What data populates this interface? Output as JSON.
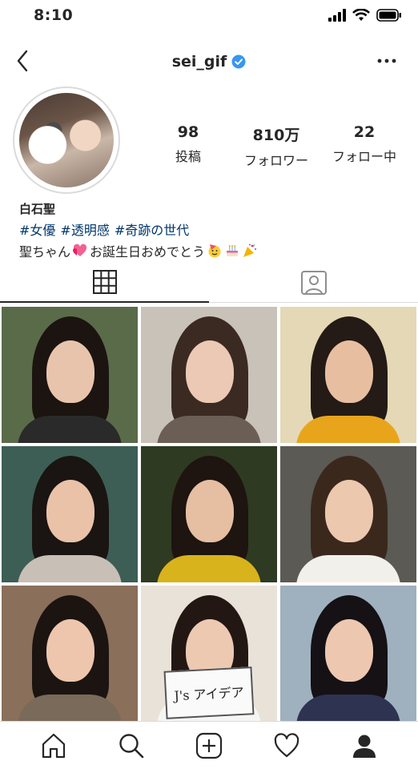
{
  "status_bar": {
    "time": "8:10"
  },
  "header": {
    "username": "sei_gif"
  },
  "profile": {
    "stats": [
      {
        "num": "98",
        "label": "投稿"
      },
      {
        "num": "810万",
        "label": "フォロワー"
      },
      {
        "num": "22",
        "label": "フォロー中"
      }
    ],
    "name": "白石聖",
    "hashtags": [
      "#女優",
      "#透明感",
      "#奇跡の世代"
    ],
    "bio_text": "聖ちゃん",
    "bio_text2": "お誕生日おめでとう"
  },
  "colors": {
    "verified": "#3897f0",
    "hashtag": "#00376b",
    "divider": "#dbdbdb",
    "text": "#262626"
  },
  "posts": [
    {
      "bg": "#5a6b4a",
      "hair": "#1c1410",
      "face": "#e9c4ad",
      "shirt": "#2a2a2a"
    },
    {
      "bg": "#c9c2b8",
      "hair": "#3a2a22",
      "face": "#ecc9b4",
      "shirt": "#6b5e55"
    },
    {
      "bg": "#e4d8b6",
      "hair": "#241a16",
      "face": "#e7bfa0",
      "shirt": "#e8a51c"
    },
    {
      "bg": "#3d5e55",
      "hair": "#1a1412",
      "face": "#e9c2a8",
      "shirt": "#c8bfb6"
    },
    {
      "bg": "#2e3a22",
      "hair": "#1e1410",
      "face": "#e6bea2",
      "shirt": "#d9b31b"
    },
    {
      "bg": "#5b5a54",
      "hair": "#3b281d",
      "face": "#ecc8ae",
      "shirt": "#f2f0ea"
    },
    {
      "bg": "#8a6f5a",
      "hair": "#1c1411",
      "face": "#edc6ad",
      "shirt": "#7a6a5a"
    },
    {
      "bg": "#e9e2d8",
      "hair": "#231713",
      "face": "#eec9b2",
      "shirt": "#f5f5f3"
    },
    {
      "bg": "#9fb0bf",
      "hair": "#151115",
      "face": "#edc7b0",
      "shirt": "#2d3350"
    }
  ],
  "post_caption": "J's アイデア",
  "icons": [
    "back-icon",
    "verified-icon",
    "more-icon",
    "grid-icon",
    "tagged-icon",
    "home-icon",
    "search-icon",
    "add-icon",
    "heart-icon",
    "profile-icon",
    "signal-icon",
    "wifi-icon",
    "battery-icon"
  ]
}
